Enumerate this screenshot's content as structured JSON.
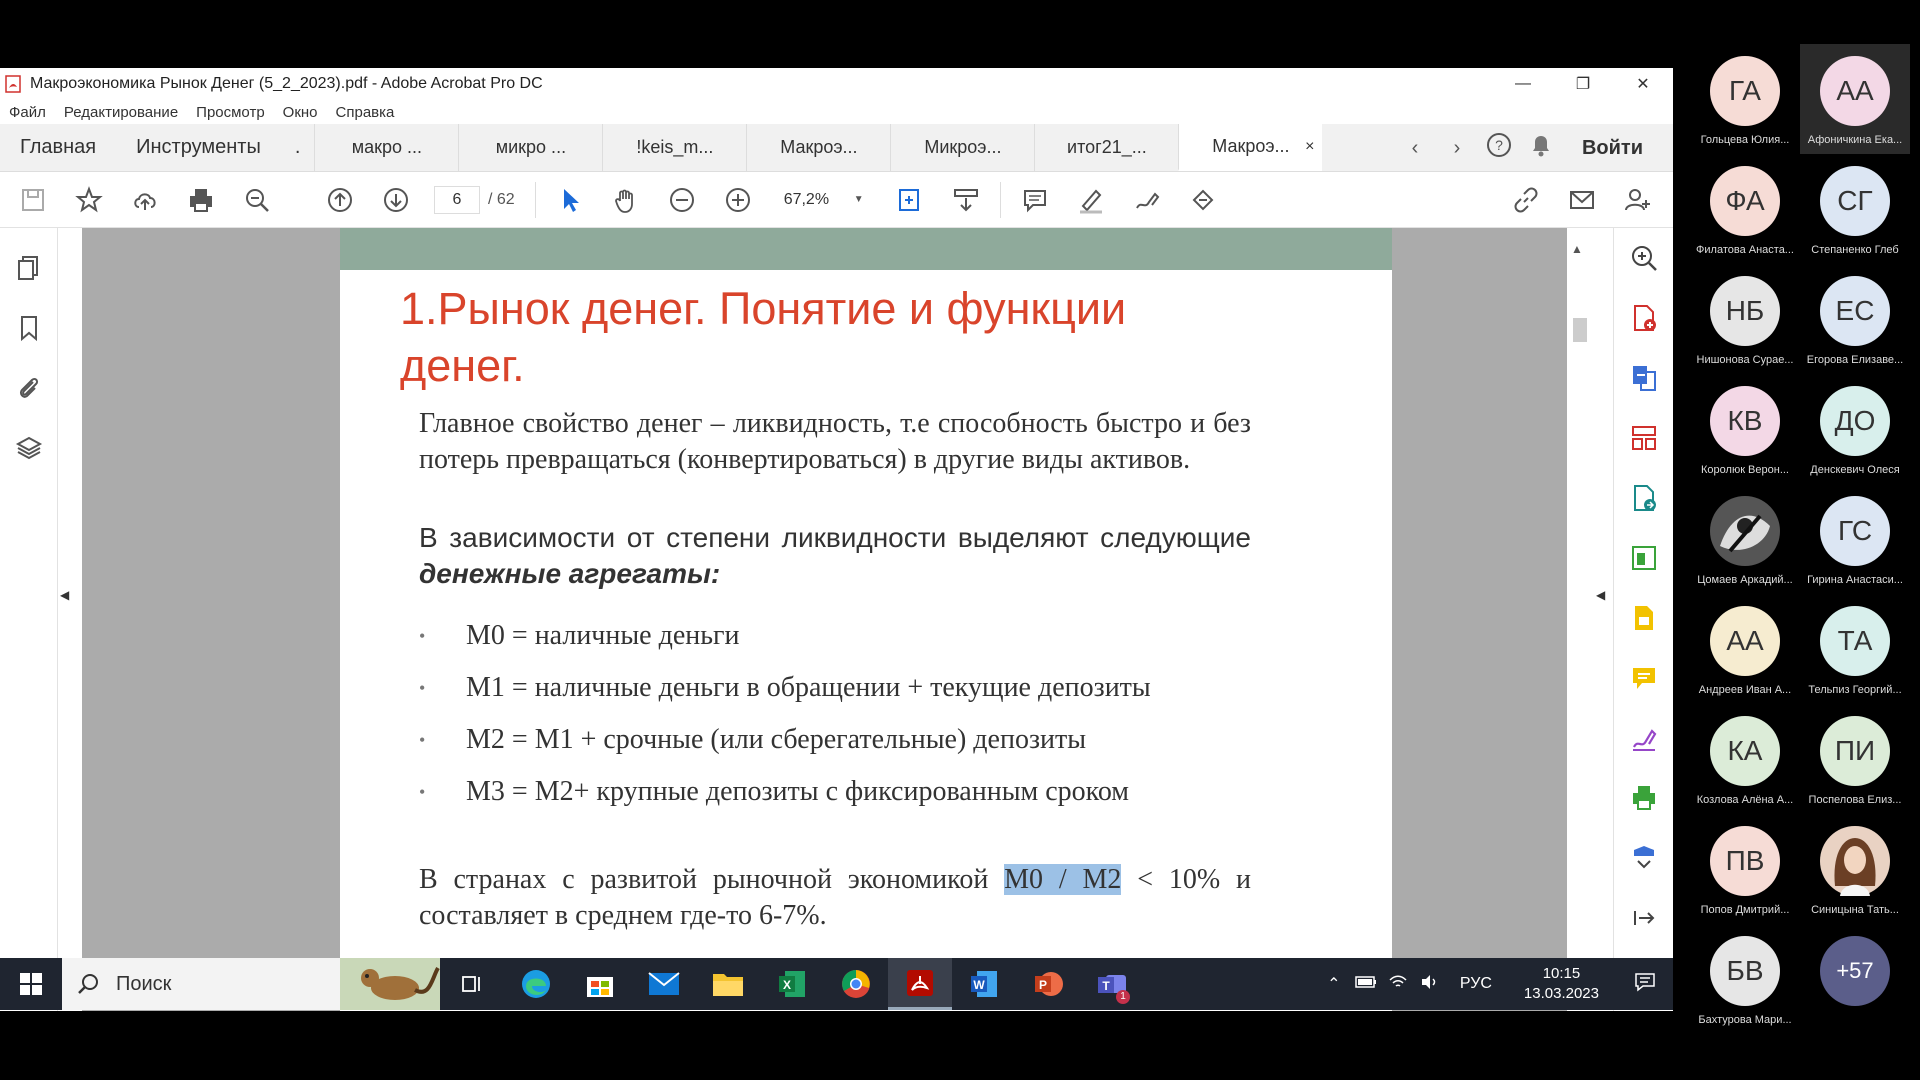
{
  "window": {
    "title": "Макроэкономика Рынок Денег (5_2_2023).pdf - Adobe Acrobat Pro DC",
    "controls": [
      "—",
      "❐",
      "✕"
    ]
  },
  "menu": [
    "Файл",
    "Редактирование",
    "Просмотр",
    "Окно",
    "Справка"
  ],
  "tabs": {
    "home": "Главная",
    "tools": "Инструменты",
    "dot": ".",
    "docs": [
      "макро ...",
      "микро ...",
      "!keis_m...",
      "Макроэ...",
      "Микроэ...",
      "итог21_..."
    ],
    "active": "Макроэ...",
    "close": "×",
    "signin": "Войти"
  },
  "toolbar": {
    "page_current": "6",
    "page_total": "/ 62",
    "zoom": "67,2%"
  },
  "slide": {
    "title_line1": "1.Рынок денег. Понятие и функции",
    "title_line2": "денег.",
    "para1": "Главное свойство денег – ликвидность, т.е способность быстро и без потерь превращаться (конвертироваться) в другие виды активов.",
    "para2_lead": "В зависимости от степени ликвидности выделяют следующие ",
    "para2_emph": "денежные агрегаты:",
    "bullet_marker": "•",
    "bullets": [
      "М0 = наличные деньги",
      "М1 = наличные деньги в обращении + текущие депозиты",
      "М2 = М1 + срочные (или сберегательные) депозиты",
      "М3 = М2+ крупные депозиты с фиксированным сроком"
    ],
    "para3_before": "В странах с развитой рыночной экономикой ",
    "para3_highlight": "М0 / М2",
    "para3_after": " < 10% и составляет в среднем где-то 6-7%."
  },
  "taskbar": {
    "search_placeholder": "Поиск",
    "lang": "РУС",
    "time": "10:15",
    "date": "13.03.2023",
    "teams_badge": "1"
  },
  "participants": [
    {
      "initials": "ГА",
      "name": "Гольцева Юлия...",
      "color": "#f6dcd6"
    },
    {
      "initials": "АА",
      "name": "Афоничкина Ека...",
      "color": "#f3d8e6"
    },
    {
      "initials": "ФА",
      "name": "Филатова Анаста...",
      "color": "#f6dcd6"
    },
    {
      "initials": "СГ",
      "name": "Степаненко Глеб",
      "color": "#dce6f3"
    },
    {
      "initials": "НБ",
      "name": "Нишонова Сурае...",
      "color": "#e6e6e6"
    },
    {
      "initials": "ЕС",
      "name": "Егорова Елизаве...",
      "color": "#dce6f3"
    },
    {
      "initials": "КВ",
      "name": "Королюк Верон...",
      "color": "#f3d8e6"
    },
    {
      "initials": "ДО",
      "name": "Денскевич Олеся",
      "color": "#d8efec"
    },
    {
      "initials": "",
      "name": "Цомаев Аркадий...",
      "color": "#444444"
    },
    {
      "initials": "ГС",
      "name": "Гирина Анастаси...",
      "color": "#dce6f3"
    },
    {
      "initials": "АА",
      "name": "Андреев Иван А...",
      "color": "#f6ecd0"
    },
    {
      "initials": "ТА",
      "name": "Тельпиз Георгий...",
      "color": "#d8efec"
    },
    {
      "initials": "КА",
      "name": "Козлова Алёна А...",
      "color": "#dcecd8"
    },
    {
      "initials": "ПИ",
      "name": "Поспелова Елиз...",
      "color": "#dcecd8"
    },
    {
      "initials": "ПВ",
      "name": "Попов Дмитрий...",
      "color": "#f6dcd6"
    },
    {
      "initials": "",
      "name": "Синицына Тать...",
      "color": "#e9d2c3"
    },
    {
      "initials": "БВ",
      "name": "Бахтурова Мари...",
      "color": "#e6e6e6"
    },
    {
      "initials": "+57",
      "name": "",
      "color": "#5b5e8a"
    }
  ]
}
